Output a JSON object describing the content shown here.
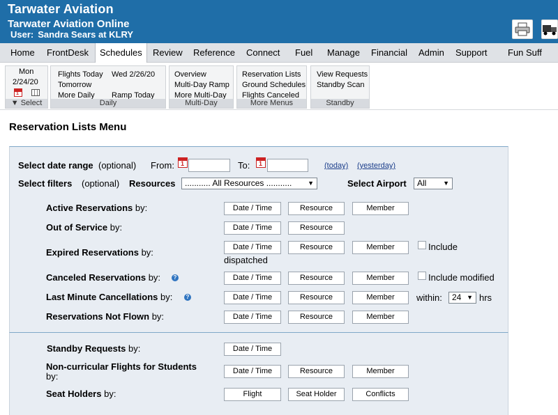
{
  "header": {
    "brand": "Tarwater Aviation",
    "app_title": "Tarwater Aviation Online",
    "user_label": "User:",
    "user_value": "Sandra Sears at KLRY",
    "icons": [
      "printer-icon",
      "truck-icon"
    ]
  },
  "nav": {
    "items": [
      "Home",
      "FrontDesk",
      "Schedules",
      "Review",
      "Reference",
      "Connect",
      "Fuel",
      "Manage",
      "Financial",
      "Admin",
      "Support",
      "Fun Suff"
    ],
    "active": "Schedules"
  },
  "ribbon": {
    "select": {
      "day": "Mon",
      "date": "2/24/20",
      "footer": "Select"
    },
    "daily": {
      "items": [
        "Flights Today",
        "Tomorrow",
        "More Daily",
        "Wed 2/26/20",
        "Ramp Today"
      ],
      "footer": "Daily"
    },
    "multiday": {
      "items": [
        "Overview",
        "Multi-Day Ramp",
        "More Multi-Day"
      ],
      "footer": "Multi-Day"
    },
    "more_menus": {
      "items": [
        "Reservation Lists",
        "Ground Schedules",
        "Flights Canceled"
      ],
      "footer": "More Menus"
    },
    "standby": {
      "items": [
        "View Requests",
        "Standby Scan"
      ],
      "footer": "Standby"
    }
  },
  "page": {
    "title": "Reservation Lists Menu",
    "date_range": {
      "label": "Select date range",
      "optional": "(optional)",
      "from_label": "From:",
      "to_label": "To:",
      "from_value": "",
      "to_value": "",
      "today_link": "(today)",
      "yesterday_link": "(yesterday)"
    },
    "filters": {
      "label": "Select filters",
      "optional": "(optional)",
      "resources_label": "Resources",
      "resources_value": "........... All Resources ...........",
      "airport_label": "Select Airport",
      "airport_value": "All"
    },
    "rows": {
      "active": {
        "label": "Active Reservations",
        "by": "by:",
        "buttons": [
          "Date / Time",
          "Resource",
          "Member"
        ]
      },
      "oos": {
        "label": "Out of Service",
        "by": "by:",
        "buttons": [
          "Date / Time",
          "Resource"
        ]
      },
      "expired": {
        "label": "Expired Reservations",
        "by": "by:",
        "buttons": [
          "Date / Time",
          "Resource",
          "Member"
        ],
        "checkbox_label": "Include",
        "extra": "dispatched"
      },
      "canceled": {
        "label": "Canceled Reservations",
        "by": "by:",
        "buttons": [
          "Date / Time",
          "Resource",
          "Member"
        ],
        "checkbox_label": "Include modified"
      },
      "last_minute": {
        "label": "Last Minute Cancellations",
        "by": "by:",
        "buttons": [
          "Date / Time",
          "Resource",
          "Member"
        ],
        "within_label": "within:",
        "within_value": "24",
        "hrs": "hrs"
      },
      "not_flown": {
        "label": "Reservations Not Flown",
        "by": "by:",
        "buttons": [
          "Date / Time",
          "Resource",
          "Member"
        ]
      },
      "standby": {
        "label": "Standby Requests",
        "by": "by:",
        "buttons": [
          "Date / Time"
        ]
      },
      "noncurricular": {
        "label": "Non-curricular Flights for Students",
        "by": "by:",
        "buttons": [
          "Date / Time",
          "Resource",
          "Member"
        ]
      },
      "seat_holders": {
        "label": "Seat Holders",
        "by": "by:",
        "buttons": [
          "Flight",
          "Seat Holder",
          "Conflicts"
        ]
      }
    }
  }
}
